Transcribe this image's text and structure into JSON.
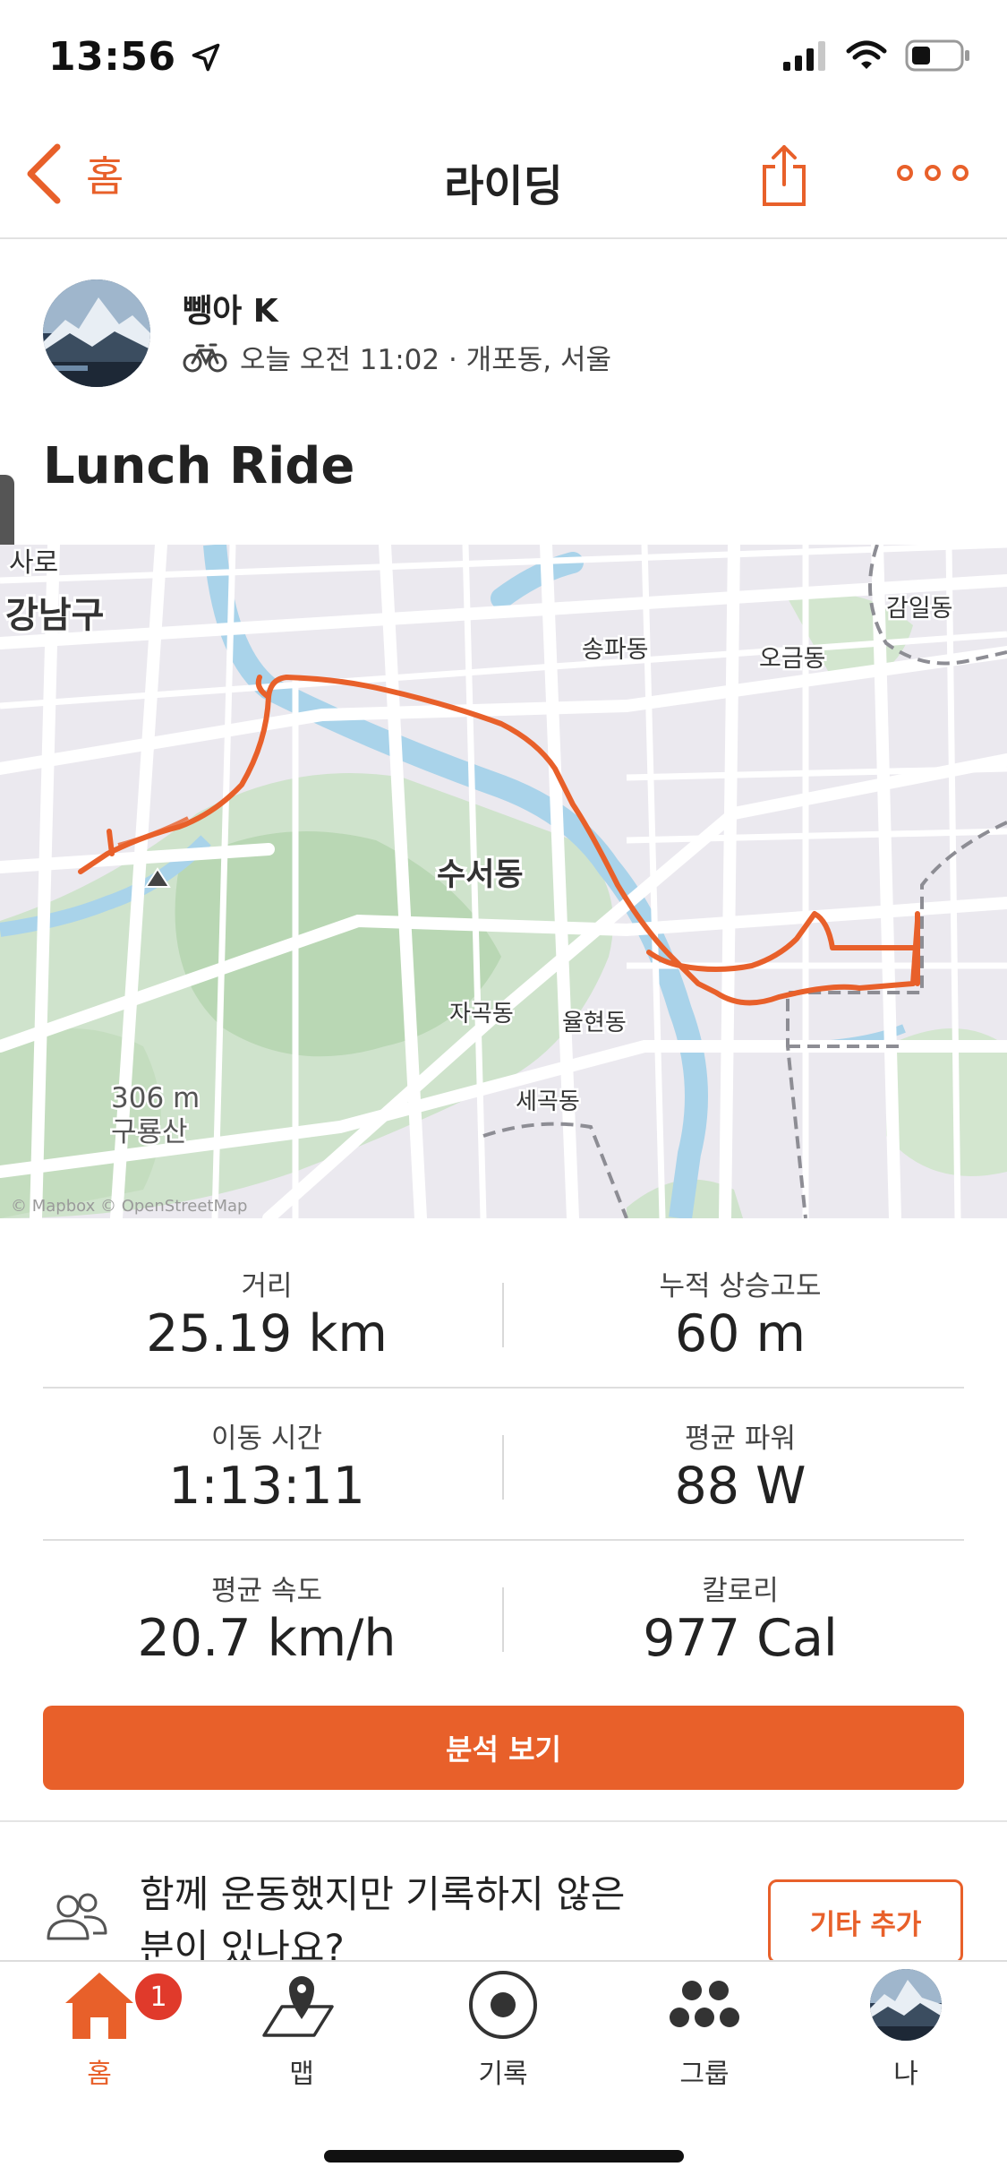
{
  "status": {
    "time": "13:56"
  },
  "nav": {
    "back_label": "홈",
    "title": "라이딩"
  },
  "profile": {
    "name": "뺑아 K",
    "meta": "오늘 오전 11:02 · 개포동, 서울"
  },
  "activity": {
    "title": "Lunch Ride"
  },
  "map": {
    "labels": {
      "gangnam": "강남구",
      "saro": "사로",
      "songpa": "송파동",
      "ogeum": "오금동",
      "gamil": "감일동",
      "suseo": "수서동",
      "jagok": "자곡동",
      "yulhyeon": "율현동",
      "segok": "세곡동",
      "mountain_height": "306 m",
      "mountain_name": "구룡산"
    },
    "attribution": "© Mapbox © OpenStreetMap",
    "route_color": "#e8602a"
  },
  "stats": [
    {
      "label": "거리",
      "value": "25.19 km"
    },
    {
      "label": "누적 상승고도",
      "value": "60 m"
    },
    {
      "label": "이동 시간",
      "value": "1:13:11"
    },
    {
      "label": "평균 파워",
      "value": "88 W"
    },
    {
      "label": "평균 속도",
      "value": "20.7 km/h"
    },
    {
      "label": "칼로리",
      "value": "977 Cal"
    }
  ],
  "analyze_button": "분석 보기",
  "companion": {
    "text": "함께 운동했지만 기록하지 않은 분이 있나요?",
    "button": "기타 추가"
  },
  "tabs": [
    {
      "label": "홈",
      "icon": "home-icon",
      "badge": "1",
      "active": true
    },
    {
      "label": "맵",
      "icon": "map-icon"
    },
    {
      "label": "기록",
      "icon": "record-icon"
    },
    {
      "label": "그룹",
      "icon": "groups-icon"
    },
    {
      "label": "나",
      "icon": "profile-avatar"
    }
  ],
  "colors": {
    "accent": "#e8602a",
    "badge": "#e03a2b"
  }
}
